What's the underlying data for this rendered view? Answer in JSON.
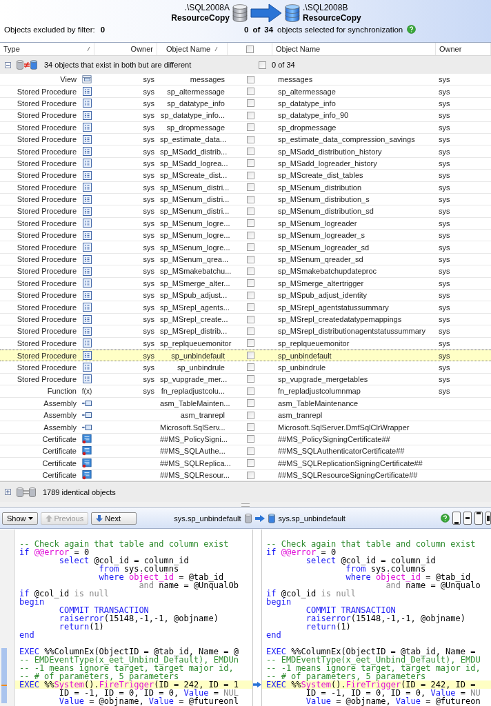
{
  "header": {
    "source": {
      "server": ".\\SQL2008A",
      "database": "ResourceCopy"
    },
    "target": {
      "server": ".\\SQL2008B",
      "database": "ResourceCopy"
    },
    "excluded": {
      "label": "Objects excluded by filter:",
      "count": "0"
    },
    "selection": {
      "selected": "0",
      "of": "of",
      "total": "34",
      "label": "objects selected for synchronization"
    }
  },
  "columns": [
    {
      "label": "Type",
      "sortable": true
    },
    {
      "label": "Owner",
      "sortable": false
    },
    {
      "label": "Object Name",
      "sortable": true
    },
    {
      "kind": "checkbox",
      "checked": false
    },
    {
      "label": "Object Name",
      "sortable": false
    },
    {
      "label": "Owner",
      "sortable": false
    }
  ],
  "different_group": {
    "expanded": true,
    "label": "34 objects that exist in both but are different",
    "checked": false,
    "count": "0 of 34"
  },
  "rows": [
    {
      "type": "View",
      "kind": "view",
      "owner": "sys",
      "name": "messages",
      "checked": false,
      "target_name": "messages",
      "target_owner": "sys",
      "selected": false
    },
    {
      "type": "Stored Procedure",
      "kind": "procedure",
      "owner": "sys",
      "name": "sp_altermessage",
      "checked": false,
      "target_name": "sp_altermessage",
      "target_owner": "sys",
      "selected": false
    },
    {
      "type": "Stored Procedure",
      "kind": "procedure",
      "owner": "sys",
      "name": "sp_datatype_info",
      "checked": false,
      "target_name": "sp_datatype_info",
      "target_owner": "sys",
      "selected": false
    },
    {
      "type": "Stored Procedure",
      "kind": "procedure",
      "owner": "sys",
      "name": "sp_datatype_info...",
      "checked": false,
      "target_name": "sp_datatype_info_90",
      "target_owner": "sys",
      "selected": false
    },
    {
      "type": "Stored Procedure",
      "kind": "procedure",
      "owner": "sys",
      "name": "sp_dropmessage",
      "checked": false,
      "target_name": "sp_dropmessage",
      "target_owner": "sys",
      "selected": false
    },
    {
      "type": "Stored Procedure",
      "kind": "procedure",
      "owner": "sys",
      "name": "sp_estimate_data...",
      "checked": false,
      "target_name": "sp_estimate_data_compression_savings",
      "target_owner": "sys",
      "selected": false
    },
    {
      "type": "Stored Procedure",
      "kind": "procedure",
      "owner": "sys",
      "name": "sp_MSadd_distrib...",
      "checked": false,
      "target_name": "sp_MSadd_distribution_history",
      "target_owner": "sys",
      "selected": false
    },
    {
      "type": "Stored Procedure",
      "kind": "procedure",
      "owner": "sys",
      "name": "sp_MSadd_logrea...",
      "checked": false,
      "target_name": "sp_MSadd_logreader_history",
      "target_owner": "sys",
      "selected": false
    },
    {
      "type": "Stored Procedure",
      "kind": "procedure",
      "owner": "sys",
      "name": "sp_MScreate_dist...",
      "checked": false,
      "target_name": "sp_MScreate_dist_tables",
      "target_owner": "sys",
      "selected": false
    },
    {
      "type": "Stored Procedure",
      "kind": "procedure",
      "owner": "sys",
      "name": "sp_MSenum_distri...",
      "checked": false,
      "target_name": "sp_MSenum_distribution",
      "target_owner": "sys",
      "selected": false
    },
    {
      "type": "Stored Procedure",
      "kind": "procedure",
      "owner": "sys",
      "name": "sp_MSenum_distri...",
      "checked": false,
      "target_name": "sp_MSenum_distribution_s",
      "target_owner": "sys",
      "selected": false
    },
    {
      "type": "Stored Procedure",
      "kind": "procedure",
      "owner": "sys",
      "name": "sp_MSenum_distri...",
      "checked": false,
      "target_name": "sp_MSenum_distribution_sd",
      "target_owner": "sys",
      "selected": false
    },
    {
      "type": "Stored Procedure",
      "kind": "procedure",
      "owner": "sys",
      "name": "sp_MSenum_logre...",
      "checked": false,
      "target_name": "sp_MSenum_logreader",
      "target_owner": "sys",
      "selected": false
    },
    {
      "type": "Stored Procedure",
      "kind": "procedure",
      "owner": "sys",
      "name": "sp_MSenum_logre...",
      "checked": false,
      "target_name": "sp_MSenum_logreader_s",
      "target_owner": "sys",
      "selected": false
    },
    {
      "type": "Stored Procedure",
      "kind": "procedure",
      "owner": "sys",
      "name": "sp_MSenum_logre...",
      "checked": false,
      "target_name": "sp_MSenum_logreader_sd",
      "target_owner": "sys",
      "selected": false
    },
    {
      "type": "Stored Procedure",
      "kind": "procedure",
      "owner": "sys",
      "name": "sp_MSenum_qrea...",
      "checked": false,
      "target_name": "sp_MSenum_qreader_sd",
      "target_owner": "sys",
      "selected": false
    },
    {
      "type": "Stored Procedure",
      "kind": "procedure",
      "owner": "sys",
      "name": "sp_MSmakebatchu...",
      "checked": false,
      "target_name": "sp_MSmakebatchupdateproc",
      "target_owner": "sys",
      "selected": false
    },
    {
      "type": "Stored Procedure",
      "kind": "procedure",
      "owner": "sys",
      "name": "sp_MSmerge_alter...",
      "checked": false,
      "target_name": "sp_MSmerge_altertrigger",
      "target_owner": "sys",
      "selected": false
    },
    {
      "type": "Stored Procedure",
      "kind": "procedure",
      "owner": "sys",
      "name": "sp_MSpub_adjust...",
      "checked": false,
      "target_name": "sp_MSpub_adjust_identity",
      "target_owner": "sys",
      "selected": false
    },
    {
      "type": "Stored Procedure",
      "kind": "procedure",
      "owner": "sys",
      "name": "sp_MSrepl_agents...",
      "checked": false,
      "target_name": "sp_MSrepl_agentstatussummary",
      "target_owner": "sys",
      "selected": false
    },
    {
      "type": "Stored Procedure",
      "kind": "procedure",
      "owner": "sys",
      "name": "sp_MSrepl_create...",
      "checked": false,
      "target_name": "sp_MSrepl_createdatatypemappings",
      "target_owner": "sys",
      "selected": false
    },
    {
      "type": "Stored Procedure",
      "kind": "procedure",
      "owner": "sys",
      "name": "sp_MSrepl_distrib...",
      "checked": false,
      "target_name": "sp_MSrepl_distributionagentstatussummary",
      "target_owner": "sys",
      "selected": false
    },
    {
      "type": "Stored Procedure",
      "kind": "procedure",
      "owner": "sys",
      "name": "sp_replqueuemonitor",
      "checked": false,
      "target_name": "sp_replqueuemonitor",
      "target_owner": "sys",
      "selected": false
    },
    {
      "type": "Stored Procedure",
      "kind": "procedure",
      "owner": "sys",
      "name": "sp_unbindefault",
      "checked": false,
      "target_name": "sp_unbindefault",
      "target_owner": "sys",
      "selected": true
    },
    {
      "type": "Stored Procedure",
      "kind": "procedure",
      "owner": "sys",
      "name": "sp_unbindrule",
      "checked": false,
      "target_name": "sp_unbindrule",
      "target_owner": "sys",
      "selected": false
    },
    {
      "type": "Stored Procedure",
      "kind": "procedure",
      "owner": "sys",
      "name": "sp_vupgrade_mer...",
      "checked": false,
      "target_name": "sp_vupgrade_mergetables",
      "target_owner": "sys",
      "selected": false
    },
    {
      "type": "Function",
      "kind": "function",
      "icon_label": "f(x)",
      "owner": "sys",
      "name": "fn_repladjustcolu...",
      "checked": false,
      "target_name": "fn_repladjustcolumnmap",
      "target_owner": "sys",
      "selected": false
    },
    {
      "type": "Assembly",
      "kind": "assembly",
      "name": "asm_TableMainten...",
      "checked": false,
      "target_name": "asm_TableMaintenance",
      "selected": false
    },
    {
      "type": "Assembly",
      "kind": "assembly",
      "name": "asm_tranrepl",
      "checked": false,
      "target_name": "asm_tranrepl",
      "selected": false
    },
    {
      "type": "Assembly",
      "kind": "assembly",
      "name": "Microsoft.SqlServ...",
      "checked": false,
      "target_name": "Microsoft.SqlServer.DmfSqlClrWrapper",
      "selected": false
    },
    {
      "type": "Certificate",
      "kind": "certificate",
      "name": "##MS_PolicySigni...",
      "checked": false,
      "target_name": "##MS_PolicySigningCertificate##",
      "selected": false
    },
    {
      "type": "Certificate",
      "kind": "certificate",
      "name": "##MS_SQLAuthe...",
      "checked": false,
      "target_name": "##MS_SQLAuthenticatorCertificate##",
      "selected": false
    },
    {
      "type": "Certificate",
      "kind": "certificate",
      "name": "##MS_SQLReplica...",
      "checked": false,
      "target_name": "##MS_SQLReplicationSigningCertificate##",
      "selected": false
    },
    {
      "type": "Certificate",
      "kind": "certificate",
      "name": "##MS_SQLResour...",
      "checked": false,
      "target_name": "##MS_SQLResourceSigningCertificate##",
      "selected": false
    }
  ],
  "identical_group": {
    "expanded": false,
    "label": "1789 identical objects"
  },
  "toolbar": {
    "show": "Show",
    "previous": {
      "label": "Previous",
      "disabled": true
    },
    "next": {
      "label": "Next",
      "disabled": false
    },
    "source_object": "sys.sp_unbindefault",
    "target_object": "sys.sp_unbindefault"
  },
  "code_left": [
    {
      "highlighted": false,
      "tokens": [
        {
          "text": "-- Check again that table and column exist",
          "kind": "comment"
        }
      ]
    },
    {
      "highlighted": false,
      "tokens": [
        {
          "text": "if",
          "kind": "keyword"
        },
        {
          "text": " @@error",
          "kind": "system"
        },
        {
          "text": " = 0",
          "kind": "plain"
        }
      ]
    },
    {
      "highlighted": false,
      "tokens": [
        {
          "text": "        select",
          "kind": "keyword"
        },
        {
          "text": " @col_id = column_id",
          "kind": "plain"
        }
      ]
    },
    {
      "highlighted": false,
      "tokens": [
        {
          "text": "                from",
          "kind": "keyword"
        },
        {
          "text": " sys.columns",
          "kind": "plain"
        }
      ]
    },
    {
      "highlighted": false,
      "tokens": [
        {
          "text": "                where",
          "kind": "keyword"
        },
        {
          "text": " object_id",
          "kind": "system"
        },
        {
          "text": " = @tab_id",
          "kind": "plain"
        }
      ]
    },
    {
      "highlighted": false,
      "tokens": [
        {
          "text": "                        and",
          "kind": "grey"
        },
        {
          "text": " name = @UnqualOb",
          "kind": "plain"
        }
      ]
    },
    {
      "highlighted": false,
      "tokens": [
        {
          "text": "if",
          "kind": "keyword"
        },
        {
          "text": " @col_id ",
          "kind": "plain"
        },
        {
          "text": "is null",
          "kind": "grey"
        }
      ]
    },
    {
      "highlighted": false,
      "tokens": [
        {
          "text": "begin",
          "kind": "keyword"
        }
      ]
    },
    {
      "highlighted": false,
      "tokens": [
        {
          "text": "        COMMIT TRANSACTION",
          "kind": "keyword"
        }
      ]
    },
    {
      "highlighted": false,
      "tokens": [
        {
          "text": "        raiserror",
          "kind": "keyword"
        },
        {
          "text": "(15148,-1,-1, @objname)",
          "kind": "plain"
        }
      ]
    },
    {
      "highlighted": false,
      "tokens": [
        {
          "text": "        return",
          "kind": "keyword"
        },
        {
          "text": "(1)",
          "kind": "plain"
        }
      ]
    },
    {
      "highlighted": false,
      "tokens": [
        {
          "text": "end",
          "kind": "keyword"
        }
      ]
    },
    {
      "highlighted": false
    },
    {
      "highlighted": false,
      "tokens": [
        {
          "text": "EXEC",
          "kind": "keyword"
        },
        {
          "text": " %%ColumnEx(ObjectID = @tab_id, Name = @",
          "kind": "plain"
        }
      ]
    },
    {
      "highlighted": false,
      "tokens": [
        {
          "text": "-- EMDEventType(x_eet_Unbind_Default), EMDUn",
          "kind": "comment"
        }
      ]
    },
    {
      "highlighted": false,
      "tokens": [
        {
          "text": "-- -1 means ignore target, target major id,",
          "kind": "comment"
        }
      ]
    },
    {
      "highlighted": false,
      "tokens": [
        {
          "text": "-- # of parameters, 5 parameters",
          "kind": "comment"
        }
      ]
    },
    {
      "highlighted": true,
      "tokens": [
        {
          "text": "EXEC",
          "kind": "keyword"
        },
        {
          "text": " %%",
          "kind": "plain"
        },
        {
          "text": "System",
          "kind": "system"
        },
        {
          "text": "().",
          "kind": "plain"
        },
        {
          "text": "FireTrigger",
          "kind": "system"
        },
        {
          "text": "(ID = 242, ID = 1",
          "kind": "plain"
        }
      ]
    },
    {
      "highlighted": false,
      "tokens": [
        {
          "text": "        ID = -1, ID = 0, ID = 0, ",
          "kind": "plain"
        },
        {
          "text": "Value",
          "kind": "keyword"
        },
        {
          "text": " = ",
          "kind": "plain"
        },
        {
          "text": "NUL",
          "kind": "grey"
        }
      ]
    },
    {
      "highlighted": false,
      "tokens": [
        {
          "text": "        Value",
          "kind": "keyword"
        },
        {
          "text": " = @objname, ",
          "kind": "plain"
        },
        {
          "text": "Value",
          "kind": "keyword"
        },
        {
          "text": " = @futureonl",
          "kind": "plain"
        }
      ]
    }
  ],
  "code_right": [
    {
      "highlighted": false,
      "tokens": [
        {
          "text": "-- Check again that table and column exist",
          "kind": "comment"
        }
      ]
    },
    {
      "highlighted": false,
      "tokens": [
        {
          "text": "if",
          "kind": "keyword"
        },
        {
          "text": " @@error",
          "kind": "system"
        },
        {
          "text": " = 0",
          "kind": "plain"
        }
      ]
    },
    {
      "highlighted": false,
      "tokens": [
        {
          "text": "        select",
          "kind": "keyword"
        },
        {
          "text": " @col_id = column_id",
          "kind": "plain"
        }
      ]
    },
    {
      "highlighted": false,
      "tokens": [
        {
          "text": "                from",
          "kind": "keyword"
        },
        {
          "text": " sys.columns",
          "kind": "plain"
        }
      ]
    },
    {
      "highlighted": false,
      "tokens": [
        {
          "text": "                where",
          "kind": "keyword"
        },
        {
          "text": " object_id",
          "kind": "system"
        },
        {
          "text": " = @tab_id",
          "kind": "plain"
        }
      ]
    },
    {
      "highlighted": false,
      "tokens": [
        {
          "text": "                        and",
          "kind": "grey"
        },
        {
          "text": " name = @Unqualo",
          "kind": "plain"
        }
      ]
    },
    {
      "highlighted": false,
      "tokens": [
        {
          "text": "if",
          "kind": "keyword"
        },
        {
          "text": " @col_id ",
          "kind": "plain"
        },
        {
          "text": "is null",
          "kind": "grey"
        }
      ]
    },
    {
      "highlighted": false,
      "tokens": [
        {
          "text": "begin",
          "kind": "keyword"
        }
      ]
    },
    {
      "highlighted": false,
      "tokens": [
        {
          "text": "        COMMIT TRANSACTION",
          "kind": "keyword"
        }
      ]
    },
    {
      "highlighted": false,
      "tokens": [
        {
          "text": "        raiserror",
          "kind": "keyword"
        },
        {
          "text": "(15148,-1,-1, @objname)",
          "kind": "plain"
        }
      ]
    },
    {
      "highlighted": false,
      "tokens": [
        {
          "text": "        return",
          "kind": "keyword"
        },
        {
          "text": "(1)",
          "kind": "plain"
        }
      ]
    },
    {
      "highlighted": false,
      "tokens": [
        {
          "text": "end",
          "kind": "keyword"
        }
      ]
    },
    {
      "highlighted": false
    },
    {
      "highlighted": false,
      "tokens": [
        {
          "text": "EXEC",
          "kind": "keyword"
        },
        {
          "text": " %%ColumnEx(ObjectID = @tab_id, Name =",
          "kind": "plain"
        }
      ]
    },
    {
      "highlighted": false,
      "tokens": [
        {
          "text": "-- EMDEventType(x_eet_Unbind_Default), EMDU",
          "kind": "comment"
        }
      ]
    },
    {
      "highlighted": false,
      "tokens": [
        {
          "text": "-- -1 means ignore target, target major id,",
          "kind": "comment"
        }
      ]
    },
    {
      "highlighted": false,
      "tokens": [
        {
          "text": "-- # of parameters, 5 parameters",
          "kind": "comment"
        }
      ]
    },
    {
      "highlighted": true,
      "tokens": [
        {
          "text": "EXEC",
          "kind": "keyword"
        },
        {
          "text": " %%",
          "kind": "plain"
        },
        {
          "text": "System",
          "kind": "system"
        },
        {
          "text": "().",
          "kind": "plain"
        },
        {
          "text": "FireTrigger",
          "kind": "system"
        },
        {
          "text": "(ID = 242, ID =",
          "kind": "plain"
        }
      ]
    },
    {
      "highlighted": false,
      "tokens": [
        {
          "text": "        ID = -1, ID = 0, ID = 0, ",
          "kind": "plain"
        },
        {
          "text": "Value",
          "kind": "keyword"
        },
        {
          "text": " = ",
          "kind": "plain"
        },
        {
          "text": "NU",
          "kind": "grey"
        }
      ]
    },
    {
      "highlighted": false,
      "tokens": [
        {
          "text": "        Value",
          "kind": "keyword"
        },
        {
          "text": " = @objname, ",
          "kind": "plain"
        },
        {
          "text": "Value",
          "kind": "keyword"
        },
        {
          "text": " = @futureon",
          "kind": "plain"
        }
      ]
    }
  ]
}
